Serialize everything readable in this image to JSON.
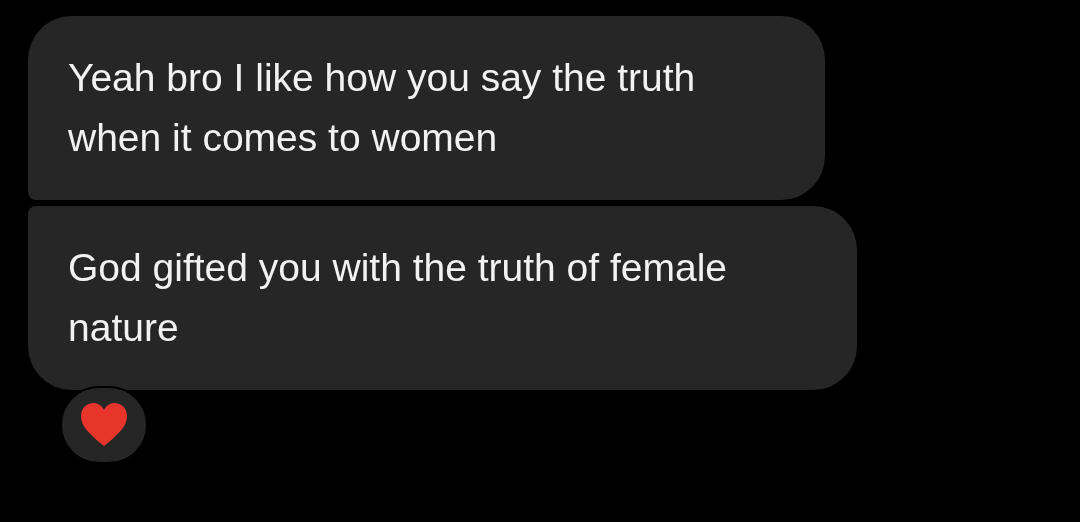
{
  "messages": [
    {
      "text": "Yeah bro I like how you say the truth when it comes to women"
    },
    {
      "text": "God gifted you with the truth of female nature"
    }
  ],
  "reaction": {
    "kind": "heart"
  }
}
